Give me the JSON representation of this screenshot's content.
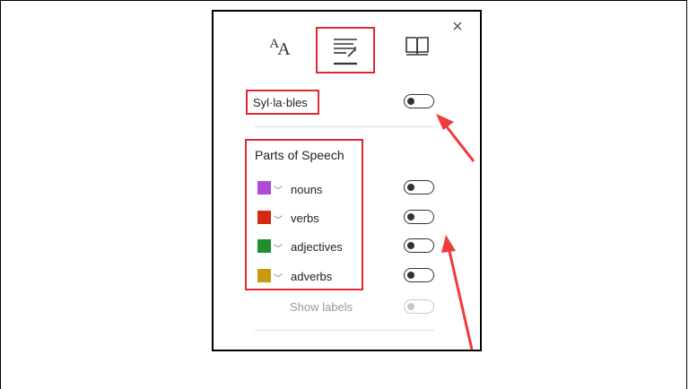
{
  "panel": {
    "close_glyph": "×",
    "tabs": [
      {
        "icon": "text-size-icon",
        "glyph": "AA"
      },
      {
        "icon": "grammar-options-icon",
        "selected": true
      },
      {
        "icon": "book-icon"
      }
    ]
  },
  "syllables": {
    "label": "Syl·la·bles",
    "on": false
  },
  "parts_of_speech": {
    "heading": "Parts of Speech",
    "items": [
      {
        "label": "nouns",
        "color": "#b04ad8",
        "on": false
      },
      {
        "label": "verbs",
        "color": "#d42a12",
        "on": false
      },
      {
        "label": "adjectives",
        "color": "#1f8f2d",
        "on": false
      },
      {
        "label": "adverbs",
        "color": "#c79a10",
        "on": false
      }
    ],
    "show_labels": {
      "label": "Show labels",
      "on": false,
      "enabled": false
    }
  },
  "colors": {
    "highlight": "#e0282e",
    "arrow": "#ef3b3b"
  }
}
